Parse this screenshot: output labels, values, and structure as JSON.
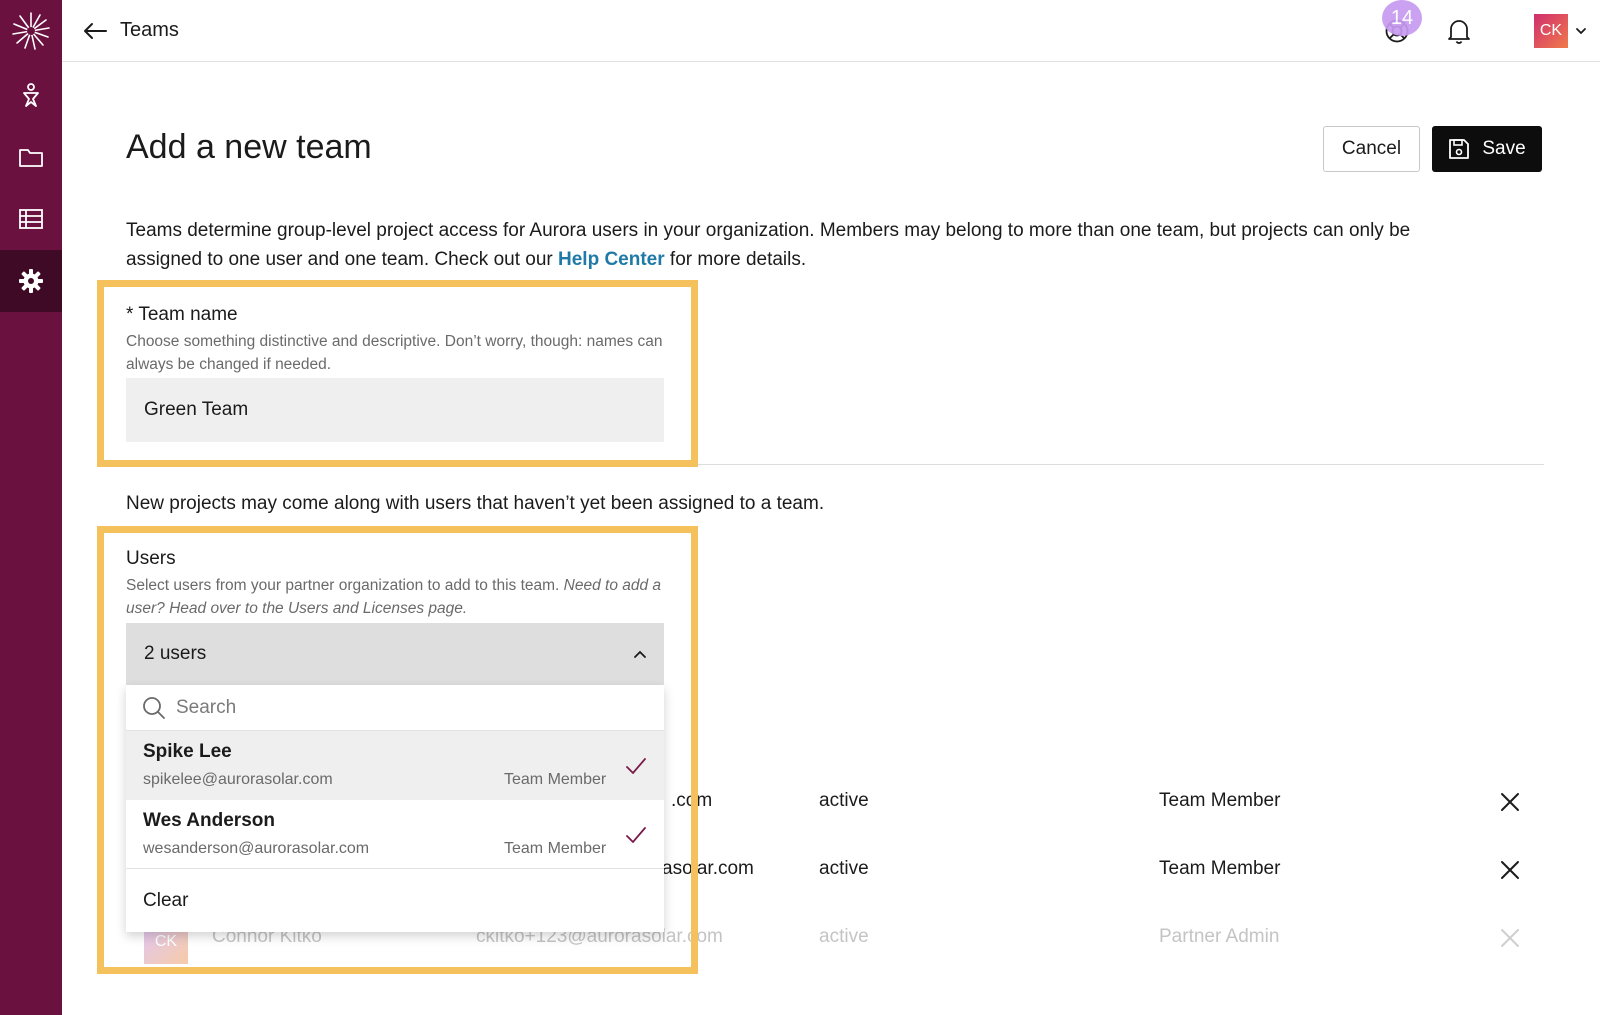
{
  "header": {
    "back_label": "Teams",
    "notification_count": "14",
    "avatar_initials": "CK"
  },
  "page": {
    "title": "Add a new team",
    "cancel_label": "Cancel",
    "save_label": "Save",
    "intro_before_link": "Teams determine group-level project access for Aurora users in your organization. Members may belong to more than one team, but projects can only be assigned to one user and one team. Check out our ",
    "intro_link": "Help Center",
    "intro_after_link": " for more details."
  },
  "team_name": {
    "label": "* Team name",
    "help": "Choose something distinctive and descriptive. Don’t worry, though: names can always be changed if needed.",
    "value": "Green Team"
  },
  "note": "New projects may come along with users that haven’t yet been assigned to a team.",
  "users": {
    "label": "Users",
    "help_plain": "Select users from your partner organization to add to this team. ",
    "help_italic": "Need to add a user? Head over to the Users and Licenses page.",
    "selected_summary": "2 users",
    "search_placeholder": "Search",
    "options": [
      {
        "name": "Spike Lee",
        "email": "spikelee@aurorasolar.com",
        "role": "Team Member",
        "checked": true
      },
      {
        "name": "Wes Anderson",
        "email": "wesanderson@aurorasolar.com",
        "role": "Team Member",
        "checked": true
      }
    ],
    "clear_label": "Clear"
  },
  "table": {
    "rows": [
      {
        "email_tail": ".com",
        "status": "active",
        "role": "Team Member"
      },
      {
        "email_tail": "asolar.com",
        "status": "active",
        "role": "Team Member"
      },
      {
        "initials": "CK",
        "name": "Connor Kitko",
        "email": "ckitko+123@aurorasolar.com",
        "status": "active",
        "role": "Partner Admin"
      }
    ]
  },
  "colors": {
    "sidebar": "#6b1140",
    "sidebar_active": "#3f0a26",
    "highlight": "#f5c15c",
    "link": "#1f7aa8",
    "check": "#7a1a4a"
  }
}
